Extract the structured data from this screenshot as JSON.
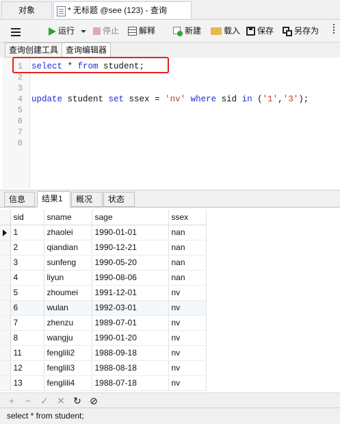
{
  "tabs": {
    "objects": "对象",
    "query_title": "* 无标题 @see (123) - 查询"
  },
  "toolbar": {
    "run": "运行",
    "stop": "停止",
    "explain": "解释",
    "new": "新建",
    "load": "载入",
    "save": "保存",
    "save_as": "另存为"
  },
  "subtabs": {
    "builder": "查询创建工具",
    "editor": "查询编辑器"
  },
  "editor": {
    "line_numbers": [
      "1",
      "2",
      "3",
      "4",
      "5",
      "6",
      "7",
      "8"
    ],
    "line1": {
      "kw1": "select",
      "mid": " * ",
      "kw2": "from",
      "rest": " student;"
    },
    "line4": {
      "kw1": "update",
      "p1": " student ",
      "kw2": "set",
      "p2": " ssex = ",
      "s1": "'nv'",
      "p3": " ",
      "kw3": "where",
      "p4": " sid ",
      "kw4": "in",
      "p5": " (",
      "s2": "'1'",
      "p6": ",",
      "s3": "'3'",
      "p7": ");"
    }
  },
  "result_tabs": {
    "info": "信息",
    "result1": "结果1",
    "profile": "概况",
    "status": "状态"
  },
  "grid": {
    "columns": [
      "sid",
      "sname",
      "sage",
      "ssex"
    ],
    "rows": [
      [
        "1",
        "zhaolei",
        "1990-01-01",
        "nan"
      ],
      [
        "2",
        "qiandian",
        "1990-12-21",
        "nan"
      ],
      [
        "3",
        "sunfeng",
        "1990-05-20",
        "nan"
      ],
      [
        "4",
        "liyun",
        "1990-08-06",
        "nan"
      ],
      [
        "5",
        "zhoumei",
        "1991-12-01",
        "nv"
      ],
      [
        "6",
        "wulan",
        "1992-03-01",
        "nv"
      ],
      [
        "7",
        "zhenzu",
        "1989-07-01",
        "nv"
      ],
      [
        "8",
        "wangju",
        "1990-01-20",
        "nv"
      ],
      [
        "11",
        "fenglili2",
        "1988-09-18",
        "nv"
      ],
      [
        "12",
        "fenglili3",
        "1988-08-18",
        "nv"
      ],
      [
        "13",
        "fenglili4",
        "1988-07-18",
        "nv"
      ]
    ]
  },
  "status_bar": {
    "text": "select * from student;"
  },
  "colors": {
    "keyword": "#1e2fd0",
    "string": "#c0392b",
    "highlight_box": "#e5211d",
    "run_icon": "#2fa52f"
  }
}
